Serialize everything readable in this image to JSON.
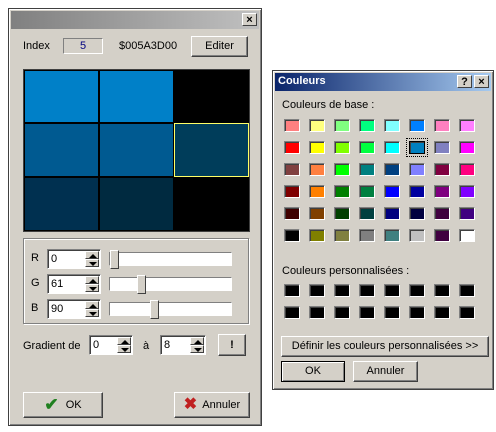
{
  "editor": {
    "index_label": "Index",
    "index_value": "5",
    "hex_value": "$005A3D00",
    "edit_button": "Editer",
    "preview_colors": [
      [
        "#0080c8",
        "#0080c8",
        "#000000"
      ],
      [
        "#005a91",
        "#005a91",
        "#003d5a"
      ],
      [
        "#003050",
        "#002a40",
        "#000000"
      ]
    ],
    "channels": [
      {
        "label": "R",
        "value": "0",
        "level": 0
      },
      {
        "label": "G",
        "value": "61",
        "level": 0.239
      },
      {
        "label": "B",
        "value": "90",
        "level": 0.353
      }
    ],
    "gradient_label": "Gradient de",
    "gradient_from": "0",
    "gradient_to_label": "à",
    "gradient_to": "8",
    "apply_button": "!",
    "ok_button": "OK",
    "cancel_button": "Annuler",
    "ok_color": "#208020",
    "cancel_color": "#c02020"
  },
  "colors_dialog": {
    "title": "Couleurs",
    "help_button": "?",
    "close_button": "×",
    "basic_label": "Couleurs de base :",
    "basic_colors": [
      [
        "#ff8080",
        "#ffff80",
        "#80ff80",
        "#00ff80",
        "#80ffff",
        "#0080ff",
        "#ff80c0",
        "#ff80ff"
      ],
      [
        "#ff0000",
        "#ffff00",
        "#80ff00",
        "#00ff40",
        "#00ffff",
        "#0080c0",
        "#8080c0",
        "#ff00ff"
      ],
      [
        "#804040",
        "#ff8040",
        "#00ff00",
        "#008080",
        "#004080",
        "#8080ff",
        "#800040",
        "#ff0080"
      ],
      [
        "#800000",
        "#ff8000",
        "#008000",
        "#008040",
        "#0000ff",
        "#0000a0",
        "#800080",
        "#8000ff"
      ],
      [
        "#400000",
        "#804000",
        "#004000",
        "#004040",
        "#000080",
        "#000040",
        "#400040",
        "#400080"
      ],
      [
        "#000000",
        "#808000",
        "#808040",
        "#808080",
        "#408080",
        "#c0c0c0",
        "#400040",
        "#ffffff"
      ]
    ],
    "selected_basic": "#0080c0",
    "custom_label": "Couleurs personnalisées :",
    "custom_colors": [
      [
        "#000000",
        "#000000",
        "#000000",
        "#000000",
        "#000000",
        "#000000",
        "#000000",
        "#000000"
      ],
      [
        "#000000",
        "#000000",
        "#000000",
        "#000000",
        "#000000",
        "#000000",
        "#000000",
        "#000000"
      ]
    ],
    "define_button": "Définir les couleurs personnalisées >>",
    "ok_button": "OK",
    "cancel_button": "Annuler"
  }
}
